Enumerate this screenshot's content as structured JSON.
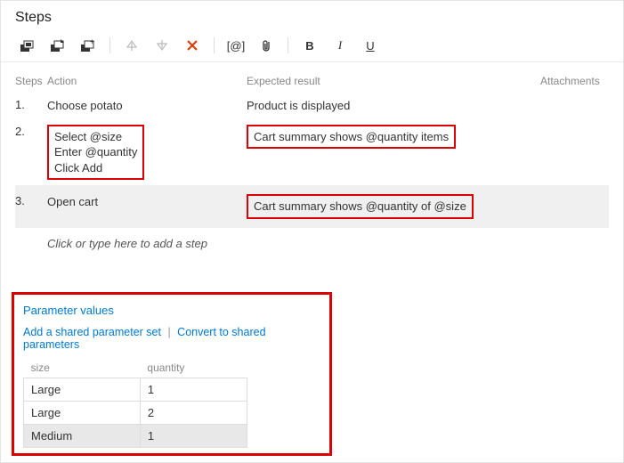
{
  "title": "Steps",
  "columns": {
    "steps": "Steps",
    "action": "Action",
    "result": "Expected result",
    "attachments": "Attachments"
  },
  "steps": [
    {
      "num": "1.",
      "action_lines": [
        "Choose potato"
      ],
      "result": "Product is displayed",
      "hl_action": false,
      "hl_result": false,
      "selected": false
    },
    {
      "num": "2.",
      "action_lines": [
        "Select @size",
        "Enter @quantity",
        "Click Add"
      ],
      "result": "Cart summary shows @quantity items",
      "hl_action": true,
      "hl_result": true,
      "selected": false
    },
    {
      "num": "3.",
      "action_lines": [
        "Open cart"
      ],
      "result": "Cart summary shows @quantity of @size",
      "hl_action": false,
      "hl_result": true,
      "selected": true
    }
  ],
  "placeholder": "Click or type here to add a step",
  "param": {
    "title": "Parameter values",
    "link_add": "Add a shared parameter set",
    "link_convert": "Convert to shared parameters",
    "headers": {
      "size": "size",
      "quantity": "quantity"
    },
    "rows": [
      {
        "size": "Large",
        "quantity": "1",
        "sel": false
      },
      {
        "size": "Large",
        "quantity": "2",
        "sel": false
      },
      {
        "size": "Medium",
        "quantity": "1",
        "sel": true
      }
    ]
  },
  "toolbar": {
    "insert": "insert-step",
    "insert_shared": "insert-shared-step",
    "new_shared": "create-shared-step",
    "up": "move-up",
    "down": "move-down",
    "delete": "delete-step",
    "param_at": "insert-parameter",
    "attach": "add-attachment",
    "bold": "B",
    "italic": "I",
    "underline": "U"
  }
}
